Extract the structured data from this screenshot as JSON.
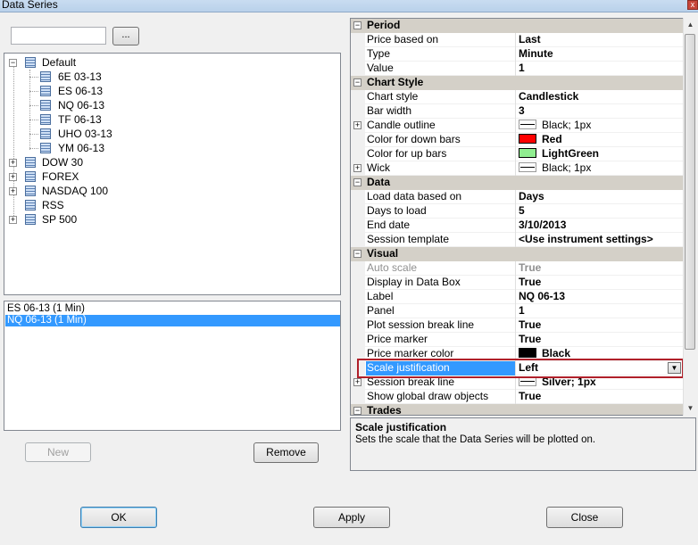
{
  "window": {
    "title": "Data Series",
    "close_glyph": "x"
  },
  "search": {
    "value": "",
    "browse_label": "..."
  },
  "tree": {
    "root": {
      "label": "Default",
      "expander": "−",
      "children": [
        "6E 03-13",
        "ES 06-13",
        "NQ 06-13",
        "TF 06-13",
        "UHO 03-13",
        "YM 06-13"
      ]
    },
    "groups": [
      {
        "label": "DOW 30",
        "expander": "+"
      },
      {
        "label": "FOREX",
        "expander": "+"
      },
      {
        "label": "NASDAQ 100",
        "expander": "+"
      },
      {
        "label": "RSS",
        "expander": ""
      },
      {
        "label": "SP 500",
        "expander": "+"
      }
    ]
  },
  "series_list": [
    {
      "label": "ES 06-13 (1 Min)",
      "selected": false
    },
    {
      "label": "NQ 06-13 (1 Min)",
      "selected": true
    }
  ],
  "buttons": {
    "new": "New",
    "remove": "Remove",
    "ok": "OK",
    "apply": "Apply",
    "close": "Close"
  },
  "grid": {
    "categories": {
      "period": "Period",
      "chart_style": "Chart Style",
      "data": "Data",
      "visual": "Visual",
      "trades": "Trades"
    },
    "period": [
      {
        "name": "Price based on",
        "value": "Last"
      },
      {
        "name": "Type",
        "value": "Minute"
      },
      {
        "name": "Value",
        "value": "1"
      }
    ],
    "chart_style": [
      {
        "name": "Chart style",
        "value": "Candlestick"
      },
      {
        "name": "Bar width",
        "value": "3"
      },
      {
        "name": "Candle outline",
        "value": "Black; 1px",
        "swatch": "line",
        "expander": "+"
      },
      {
        "name": "Color for down bars",
        "value": "Red",
        "swatch": "#ff0000"
      },
      {
        "name": "Color for up bars",
        "value": "LightGreen",
        "swatch": "#90ee90"
      },
      {
        "name": "Wick",
        "value": "Black; 1px",
        "swatch": "line",
        "expander": "+"
      }
    ],
    "data": [
      {
        "name": "Load data based on",
        "value": "Days"
      },
      {
        "name": "Days to load",
        "value": "5"
      },
      {
        "name": "End date",
        "value": "3/10/2013"
      },
      {
        "name": "Session template",
        "value": "<Use instrument settings>"
      }
    ],
    "visual": [
      {
        "name": "Auto scale",
        "value": "True",
        "disabled": true
      },
      {
        "name": "Display in Data Box",
        "value": "True"
      },
      {
        "name": "Label",
        "value": "NQ 06-13"
      },
      {
        "name": "Panel",
        "value": "1"
      },
      {
        "name": "Plot session break line",
        "value": "True"
      },
      {
        "name": "Price marker",
        "value": "True"
      },
      {
        "name": "Price marker color",
        "value": "Black",
        "swatch": "#000000"
      },
      {
        "name": "Scale justification",
        "value": "Left",
        "selected": true,
        "dropdown": "▼"
      },
      {
        "name": "Session break line",
        "value": "Silver; 1px",
        "swatch": "line",
        "expander": "+"
      },
      {
        "name": "Show global draw objects",
        "value": "True"
      }
    ],
    "collapse_glyph": "−"
  },
  "help": {
    "title": "Scale justification",
    "text": "Sets the scale that the Data Series will be plotted on."
  },
  "scrollbar": {
    "up": "▲",
    "down": "▼"
  },
  "colors": {
    "selection": "#3399ff",
    "highlight_border": "#b0202a",
    "category_bg": "#d4d0c8"
  }
}
